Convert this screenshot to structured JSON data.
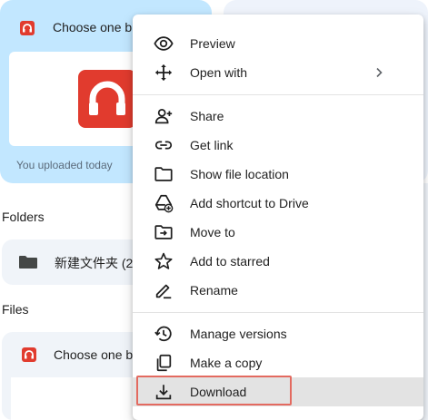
{
  "suggested_card": {
    "file_name": "Choose one b",
    "meta": "You uploaded today"
  },
  "folders": {
    "title": "Folders",
    "items": [
      {
        "name": "新建文件夹 (2"
      }
    ]
  },
  "files": {
    "title": "Files",
    "items": [
      {
        "name": "Choose one b"
      }
    ]
  },
  "context_menu": {
    "items": [
      {
        "label": "Preview",
        "icon": "eye-icon"
      },
      {
        "label": "Open with",
        "icon": "open-with-icon",
        "has_submenu": true
      },
      {
        "label": "Share",
        "icon": "person-add-icon"
      },
      {
        "label": "Get link",
        "icon": "link-icon"
      },
      {
        "label": "Show file location",
        "icon": "folder-icon"
      },
      {
        "label": "Add shortcut to Drive",
        "icon": "drive-shortcut-icon"
      },
      {
        "label": "Move to",
        "icon": "move-to-folder-icon"
      },
      {
        "label": "Add to starred",
        "icon": "star-icon"
      },
      {
        "label": "Rename",
        "icon": "pencil-icon"
      },
      {
        "label": "Manage versions",
        "icon": "history-icon"
      },
      {
        "label": "Make a copy",
        "icon": "copy-icon"
      },
      {
        "label": "Download",
        "icon": "download-icon",
        "highlighted": true
      }
    ]
  },
  "colors": {
    "suggested_card_bg": "#c2e7ff",
    "file_icon_red": "#e13b2e",
    "highlight_outline": "#e36a60",
    "menu_hover": "#e3e3e3"
  }
}
